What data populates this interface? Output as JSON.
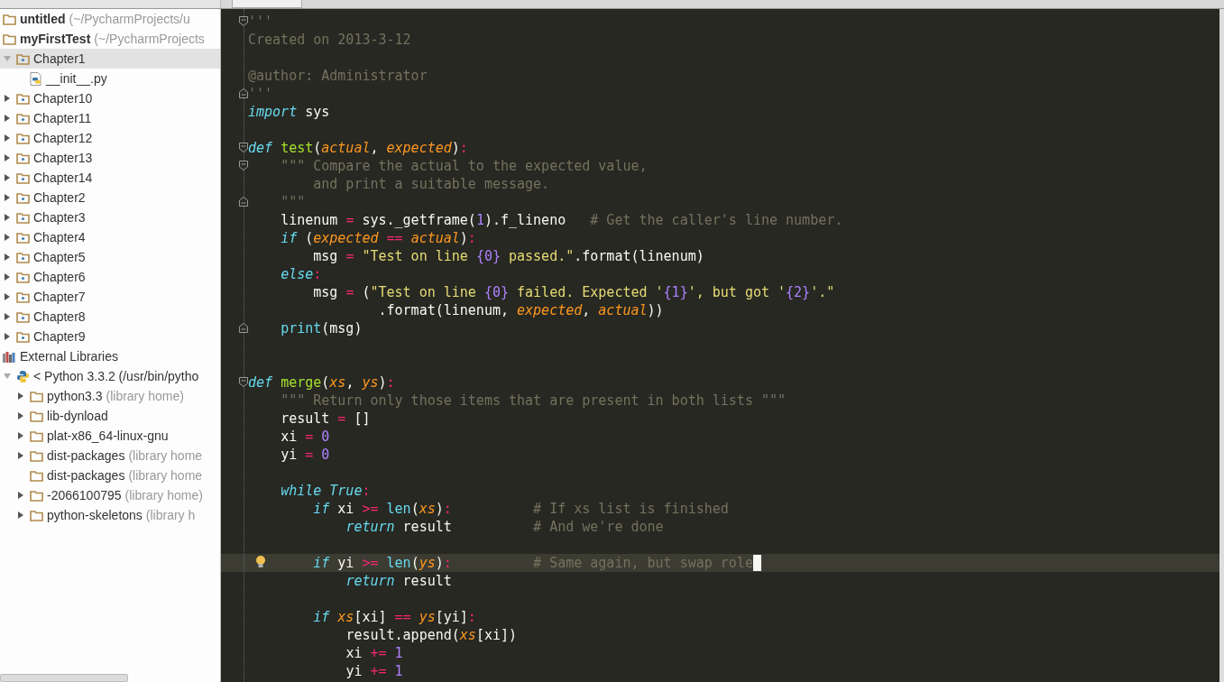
{
  "project_tree": [
    {
      "label": "untitled",
      "note": "(~/PycharmProjects/u",
      "bold": true,
      "kind": "folder",
      "selected": false
    },
    {
      "label": "myFirstTest",
      "note": "(~/PycharmProjects",
      "bold": true,
      "kind": "folder",
      "selected": false,
      "children": [
        {
          "label": "Chapter1",
          "kind": "package",
          "expanded": true,
          "selected": true,
          "children": [
            {
              "label": "__init__.py",
              "kind": "python-file",
              "selected": false
            }
          ]
        },
        {
          "label": "Chapter10",
          "kind": "package",
          "expanded": false,
          "selected": false
        },
        {
          "label": "Chapter11",
          "kind": "package",
          "expanded": false,
          "selected": false
        },
        {
          "label": "Chapter12",
          "kind": "package",
          "expanded": false,
          "selected": false
        },
        {
          "label": "Chapter13",
          "kind": "package",
          "expanded": false,
          "selected": false
        },
        {
          "label": "Chapter14",
          "kind": "package",
          "expanded": false,
          "selected": false
        },
        {
          "label": "Chapter2",
          "kind": "package",
          "expanded": false,
          "selected": false
        },
        {
          "label": "Chapter3",
          "kind": "package",
          "expanded": false,
          "selected": false
        },
        {
          "label": "Chapter4",
          "kind": "package",
          "expanded": false,
          "selected": false
        },
        {
          "label": "Chapter5",
          "kind": "package",
          "expanded": false,
          "selected": false
        },
        {
          "label": "Chapter6",
          "kind": "package",
          "expanded": false,
          "selected": false
        },
        {
          "label": "Chapter7",
          "kind": "package",
          "expanded": false,
          "selected": false
        },
        {
          "label": "Chapter8",
          "kind": "package",
          "expanded": false,
          "selected": false
        },
        {
          "label": "Chapter9",
          "kind": "package",
          "expanded": false,
          "selected": false
        }
      ]
    },
    {
      "label": "External Libraries",
      "kind": "library",
      "selected": false,
      "children": [
        {
          "label": "< Python 3.3.2 (/usr/bin/pytho",
          "kind": "python",
          "expanded": true,
          "selected": false,
          "children": [
            {
              "label": "python3.3",
              "note": "(library home)",
              "kind": "folder",
              "expanded": false,
              "selected": false
            },
            {
              "label": "lib-dynload",
              "kind": "folder",
              "expanded": false,
              "selected": false
            },
            {
              "label": "plat-x86_64-linux-gnu",
              "kind": "folder",
              "expanded": false,
              "selected": false
            },
            {
              "label": "dist-packages",
              "note": "(library home",
              "kind": "folder",
              "expanded": false,
              "selected": false
            },
            {
              "label": "dist-packages",
              "note": "(library home",
              "kind": "folder",
              "selected": false
            },
            {
              "label": "-2066100795",
              "note": "(library home)",
              "kind": "folder",
              "expanded": false,
              "selected": false
            },
            {
              "label": "python-skeletons",
              "note": "(library h",
              "kind": "folder",
              "expanded": false,
              "selected": false
            }
          ]
        }
      ]
    }
  ],
  "editor": {
    "lines": [
      {
        "kind": "code",
        "fold_start": true,
        "tokens": [
          {
            "kind": "doc",
            "text": "'''"
          }
        ]
      },
      {
        "kind": "code",
        "tokens": [
          {
            "kind": "doc",
            "text": "Created on 2013-3-12"
          }
        ]
      },
      {
        "kind": "blank"
      },
      {
        "kind": "code",
        "tokens": [
          {
            "kind": "doc",
            "text": "@author: Administrator"
          }
        ]
      },
      {
        "kind": "code",
        "fold_end": true,
        "tokens": [
          {
            "kind": "doc",
            "text": "'''"
          }
        ]
      },
      {
        "kind": "code",
        "tokens": [
          {
            "kind": "kw",
            "text": "import"
          },
          {
            "kind": "plain",
            "text": " sys"
          }
        ]
      },
      {
        "kind": "blank"
      },
      {
        "kind": "code",
        "fold_start": true,
        "tokens": [
          {
            "kind": "kw",
            "text": "def"
          },
          {
            "kind": "fn",
            "text": " test"
          },
          {
            "kind": "plain",
            "text": "("
          },
          {
            "kind": "param",
            "text": "actual"
          },
          {
            "kind": "plain",
            "text": ", "
          },
          {
            "kind": "param",
            "text": "expected"
          },
          {
            "kind": "plain",
            "text": ")"
          },
          {
            "kind": "op",
            "text": ":"
          }
        ]
      },
      {
        "kind": "code",
        "fold_start": true,
        "tokens": [
          {
            "kind": "doc",
            "text": "    \"\"\" Compare the actual to the expected value,"
          }
        ]
      },
      {
        "kind": "code",
        "tokens": [
          {
            "kind": "doc",
            "text": "        and print a suitable message."
          }
        ]
      },
      {
        "kind": "code",
        "fold_end": true,
        "tokens": [
          {
            "kind": "doc",
            "text": "    \"\"\""
          }
        ]
      },
      {
        "kind": "code",
        "tokens": [
          {
            "kind": "plain",
            "text": "    linenum "
          },
          {
            "kind": "op",
            "text": "="
          },
          {
            "kind": "plain",
            "text": " sys._getframe("
          },
          {
            "kind": "num",
            "text": "1"
          },
          {
            "kind": "plain",
            "text": ").f_lineno"
          },
          {
            "kind": "cmt",
            "text": "   # Get the caller's line number."
          }
        ]
      },
      {
        "kind": "code",
        "tokens": [
          {
            "kind": "kw",
            "text": "    if"
          },
          {
            "kind": "plain",
            "text": " ("
          },
          {
            "kind": "param",
            "text": "expected"
          },
          {
            "kind": "op",
            "text": " =="
          },
          {
            "kind": "param",
            "text": " actual"
          },
          {
            "kind": "plain",
            "text": ")"
          },
          {
            "kind": "op",
            "text": ":"
          }
        ]
      },
      {
        "kind": "code",
        "tokens": [
          {
            "kind": "plain",
            "text": "        msg "
          },
          {
            "kind": "op",
            "text": "="
          },
          {
            "kind": "str",
            "text": " \"Test on line "
          },
          {
            "kind": "num",
            "text": "{0}"
          },
          {
            "kind": "str",
            "text": " passed.\""
          },
          {
            "kind": "plain",
            "text": ".format(linenum)"
          }
        ]
      },
      {
        "kind": "code",
        "tokens": [
          {
            "kind": "kw",
            "text": "    else"
          },
          {
            "kind": "op",
            "text": ":"
          }
        ]
      },
      {
        "kind": "code",
        "tokens": [
          {
            "kind": "plain",
            "text": "        msg "
          },
          {
            "kind": "op",
            "text": "="
          },
          {
            "kind": "plain",
            "text": " ("
          },
          {
            "kind": "str",
            "text": "\"Test on line "
          },
          {
            "kind": "num",
            "text": "{0}"
          },
          {
            "kind": "str",
            "text": " failed. Expected '"
          },
          {
            "kind": "num",
            "text": "{1}"
          },
          {
            "kind": "str",
            "text": "', but got '"
          },
          {
            "kind": "num",
            "text": "{2}"
          },
          {
            "kind": "str",
            "text": "'.\""
          }
        ]
      },
      {
        "kind": "code",
        "tokens": [
          {
            "kind": "plain",
            "text": "                .format(linenum, "
          },
          {
            "kind": "param",
            "text": "expected"
          },
          {
            "kind": "plain",
            "text": ", "
          },
          {
            "kind": "param",
            "text": "actual"
          },
          {
            "kind": "plain",
            "text": "))"
          }
        ]
      },
      {
        "kind": "code",
        "fold_end": true,
        "tokens": [
          {
            "kind": "builtin",
            "text": "    print"
          },
          {
            "kind": "plain",
            "text": "(msg)"
          }
        ]
      },
      {
        "kind": "blank"
      },
      {
        "kind": "blank"
      },
      {
        "kind": "code",
        "fold_start": true,
        "tokens": [
          {
            "kind": "kw",
            "text": "def"
          },
          {
            "kind": "fn",
            "text": " merge"
          },
          {
            "kind": "plain",
            "text": "("
          },
          {
            "kind": "param",
            "text": "xs"
          },
          {
            "kind": "plain",
            "text": ", "
          },
          {
            "kind": "param",
            "text": "ys"
          },
          {
            "kind": "plain",
            "text": ")"
          },
          {
            "kind": "op",
            "text": ":"
          }
        ]
      },
      {
        "kind": "code",
        "tokens": [
          {
            "kind": "doc",
            "text": "    \"\"\" Return only those items that are present in both lists \"\"\""
          }
        ]
      },
      {
        "kind": "code",
        "tokens": [
          {
            "kind": "plain",
            "text": "    result "
          },
          {
            "kind": "op",
            "text": "="
          },
          {
            "kind": "plain",
            "text": " []"
          }
        ]
      },
      {
        "kind": "code",
        "tokens": [
          {
            "kind": "plain",
            "text": "    xi "
          },
          {
            "kind": "op",
            "text": "="
          },
          {
            "kind": "num",
            "text": " 0"
          }
        ]
      },
      {
        "kind": "code",
        "tokens": [
          {
            "kind": "plain",
            "text": "    yi "
          },
          {
            "kind": "op",
            "text": "="
          },
          {
            "kind": "num",
            "text": " 0"
          }
        ]
      },
      {
        "kind": "blank"
      },
      {
        "kind": "code",
        "tokens": [
          {
            "kind": "kw",
            "text": "    while True"
          },
          {
            "kind": "op",
            "text": ":"
          }
        ]
      },
      {
        "kind": "code",
        "tokens": [
          {
            "kind": "kw",
            "text": "        if"
          },
          {
            "kind": "plain",
            "text": " xi "
          },
          {
            "kind": "op",
            "text": ">="
          },
          {
            "kind": "builtin",
            "text": " len"
          },
          {
            "kind": "plain",
            "text": "("
          },
          {
            "kind": "param",
            "text": "xs"
          },
          {
            "kind": "plain",
            "text": ")"
          },
          {
            "kind": "op",
            "text": ":"
          },
          {
            "kind": "cmt",
            "text": "          # If xs list is finished"
          }
        ]
      },
      {
        "kind": "code",
        "tokens": [
          {
            "kind": "kw",
            "text": "            return"
          },
          {
            "kind": "plain",
            "text": " result"
          },
          {
            "kind": "cmt",
            "text": "          # And we're done"
          }
        ]
      },
      {
        "kind": "blank"
      },
      {
        "kind": "code",
        "highlighted": true,
        "caret": true,
        "tokens": [
          {
            "kind": "kw",
            "text": "        if"
          },
          {
            "kind": "plain",
            "text": " yi "
          },
          {
            "kind": "op",
            "text": ">="
          },
          {
            "kind": "builtin",
            "text": " len"
          },
          {
            "kind": "plain",
            "text": "("
          },
          {
            "kind": "param",
            "text": "ys"
          },
          {
            "kind": "plain",
            "text": ")"
          },
          {
            "kind": "op",
            "text": ":"
          },
          {
            "kind": "cmt",
            "text": "          # Same again, but swap role"
          }
        ]
      },
      {
        "kind": "code",
        "tokens": [
          {
            "kind": "kw",
            "text": "            return"
          },
          {
            "kind": "plain",
            "text": " result"
          }
        ]
      },
      {
        "kind": "blank"
      },
      {
        "kind": "code",
        "tokens": [
          {
            "kind": "kw",
            "text": "        if"
          },
          {
            "kind": "param",
            "text": " xs"
          },
          {
            "kind": "plain",
            "text": "[xi]"
          },
          {
            "kind": "op",
            "text": " =="
          },
          {
            "kind": "param",
            "text": " ys"
          },
          {
            "kind": "plain",
            "text": "[yi]"
          },
          {
            "kind": "op",
            "text": ":"
          }
        ]
      },
      {
        "kind": "code",
        "tokens": [
          {
            "kind": "plain",
            "text": "            result.append("
          },
          {
            "kind": "param",
            "text": "xs"
          },
          {
            "kind": "plain",
            "text": "[xi])"
          }
        ]
      },
      {
        "kind": "code",
        "tokens": [
          {
            "kind": "plain",
            "text": "            xi "
          },
          {
            "kind": "op",
            "text": "+="
          },
          {
            "kind": "num",
            "text": " 1"
          }
        ]
      },
      {
        "kind": "code",
        "tokens": [
          {
            "kind": "plain",
            "text": "            yi "
          },
          {
            "kind": "op",
            "text": "+="
          },
          {
            "kind": "num",
            "text": " 1"
          }
        ]
      }
    ]
  }
}
